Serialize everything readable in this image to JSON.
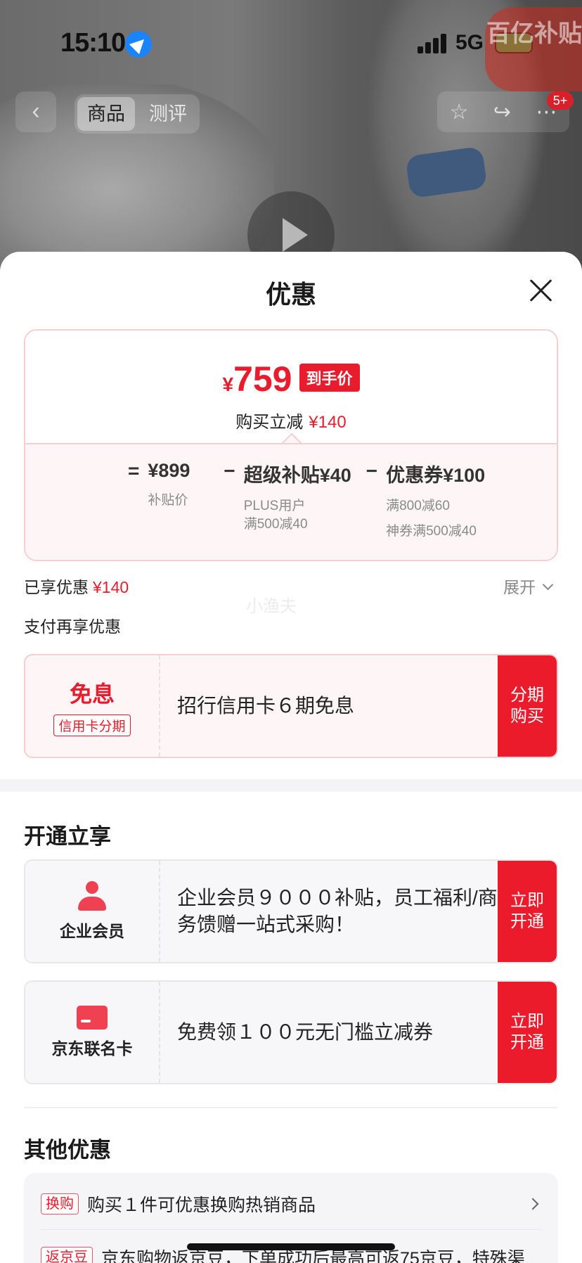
{
  "status_bar": {
    "time": "15:10",
    "network": "5G"
  },
  "top_nav": {
    "back": "‹",
    "tabs": [
      "商品",
      "测评"
    ],
    "promo_badge": "百亿补贴",
    "cart_count": "5+",
    "icons": [
      "star-icon",
      "share-icon",
      "more-icon"
    ]
  },
  "sheet": {
    "title": "优惠",
    "price": {
      "currency": "¥",
      "final": "759",
      "final_tag": "到手价",
      "cut_label": "购买立减",
      "cut_amount": "¥140",
      "formula": {
        "eq": "=",
        "base_price": "¥899",
        "base_label": "补贴价",
        "op1": "−",
        "subsidy": "超级补贴¥40",
        "subsidy_line1": "PLUS用户",
        "subsidy_line2": "满500减40",
        "op2": "−",
        "coupon": "优惠券¥100",
        "coupon_line1": "满800减60",
        "coupon_line2": "神券满500减40"
      }
    },
    "enjoyed_label": "已享优惠",
    "enjoyed_amount": "¥140",
    "expand_label": "展开",
    "watermark": "小渔夫",
    "pay_more_label": "支付再享优惠",
    "installment": {
      "big": "免息",
      "tag": "信用卡分期",
      "text": "招行信用卡６期免息",
      "button": "分期购买"
    },
    "open_section_title": "开通立享",
    "enterprise": {
      "label": "企业会员",
      "text": "企业会员９０００补贴，员工福利/商务馈赠一站式采购！",
      "button": "立即开通"
    },
    "cobrand": {
      "label": "京东联名卡",
      "text": "免费领１００元无门槛立减券",
      "button": "立即开通"
    },
    "other_section_title": "其他优惠",
    "other": [
      {
        "tag": "换购",
        "text": "购买１件可优惠换购热销商品"
      },
      {
        "tag": "返京豆",
        "text": "京东购物返京豆，下单成功后最高可返75京豆，特殊渠"
      }
    ]
  }
}
